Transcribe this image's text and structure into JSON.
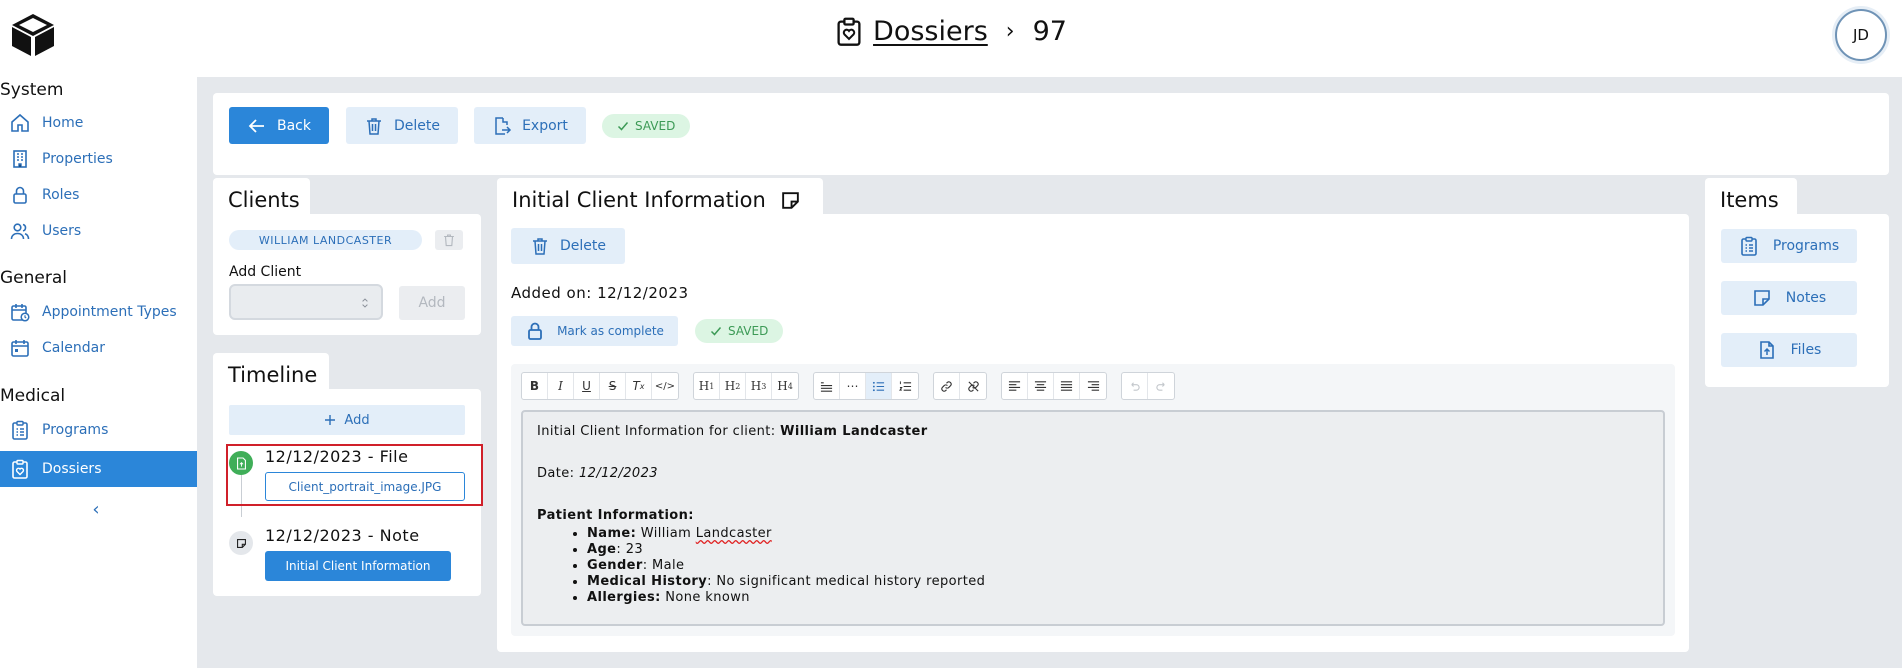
{
  "header": {
    "breadcrumb_link": "Dossiers",
    "breadcrumb_sep": "›",
    "breadcrumb_current": "97",
    "avatar_initials": "JD"
  },
  "sidebar": {
    "sections": [
      {
        "title": "System",
        "items": [
          {
            "label": "Home",
            "icon": "home-icon"
          },
          {
            "label": "Properties",
            "icon": "building-icon"
          },
          {
            "label": "Roles",
            "icon": "lock-icon"
          },
          {
            "label": "Users",
            "icon": "users-icon"
          }
        ]
      },
      {
        "title": "General",
        "items": [
          {
            "label": "Appointment Types",
            "icon": "calendar-clock-icon"
          },
          {
            "label": "Calendar",
            "icon": "calendar-icon"
          }
        ]
      },
      {
        "title": "Medical",
        "items": [
          {
            "label": "Programs",
            "icon": "clipboard-icon"
          },
          {
            "label": "Dossiers",
            "icon": "clipboard-heart-icon",
            "active": true
          }
        ]
      }
    ],
    "collapse_glyph": "‹"
  },
  "toolbar": {
    "back_label": "Back",
    "delete_label": "Delete",
    "export_label": "Export",
    "saved_label": "SAVED"
  },
  "clients": {
    "title": "Clients",
    "chip_label": "WILLIAM LANDCASTER",
    "add_client_label": "Add Client",
    "add_button_label": "Add"
  },
  "timeline": {
    "title": "Timeline",
    "add_label": "Add",
    "entries": [
      {
        "title": "12/12/2023 - File",
        "button": "Client_portrait_image.JPG"
      },
      {
        "title": "12/12/2023 - Note",
        "button": "Initial Client Information"
      }
    ]
  },
  "note": {
    "title": "Initial Client Information",
    "delete_label": "Delete",
    "added_on": "Added on: 12/12/2023",
    "mark_complete_label": "Mark as complete",
    "saved_label": "SAVED",
    "content": {
      "line1_prefix": "Initial Client Information for client: ",
      "line1_bold": "William Landcaster",
      "date_prefix": "Date: ",
      "date_value": "12/12/2023",
      "patient_heading": "Patient Information:",
      "fields": [
        {
          "label": "Name:",
          "value": " William Landcaster"
        },
        {
          "label": "Age",
          "value": ": 23"
        },
        {
          "label": "Gender",
          "value": ": Male"
        },
        {
          "label": "Medical History",
          "value": ": No significant medical history reported"
        },
        {
          "label": "Allergies:",
          "value": " None known"
        }
      ]
    }
  },
  "items": {
    "title": "Items",
    "buttons": [
      {
        "label": "Programs",
        "icon": "clipboard-icon"
      },
      {
        "label": "Notes",
        "icon": "note-icon"
      },
      {
        "label": "Files",
        "icon": "file-upload-icon"
      }
    ]
  },
  "colors": {
    "accent": "#2b86d9",
    "accent_soft": "#e3eef9",
    "saved_green": "#3c9a56",
    "main_bg": "#e5e8ec",
    "highlight_red": "#d0202a"
  }
}
